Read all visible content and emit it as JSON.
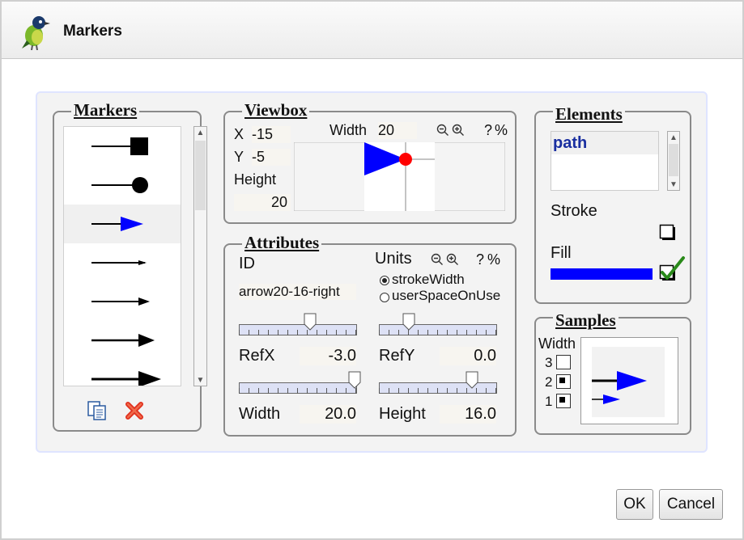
{
  "window": {
    "title": "Markers"
  },
  "markers_panel": {
    "legend": "Markers",
    "items": [
      {
        "icon": "square-end-marker-icon"
      },
      {
        "icon": "circle-end-marker-icon"
      },
      {
        "icon": "arrow-marker-icon",
        "selected": true
      },
      {
        "icon": "small-arrow-marker-icon"
      },
      {
        "icon": "medium-arrow-marker-icon"
      },
      {
        "icon": "large-arrow-marker-icon"
      },
      {
        "icon": "wide-arrow-marker-icon"
      }
    ],
    "copy_icon": "copy-icon",
    "delete_icon": "delete-icon"
  },
  "viewbox": {
    "legend": "Viewbox",
    "x_label": "X",
    "x_value": "-15",
    "y_label": "Y",
    "y_value": "-5",
    "height_label": "Height",
    "height_value": "20",
    "width_label": "Width",
    "width_value": "20",
    "help": "?",
    "percent": "%",
    "zoom_out_icon": "zoom-out-icon",
    "zoom_in_icon": "zoom-in-icon"
  },
  "attributes": {
    "legend": "Attributes",
    "id_label": "ID",
    "id_value": "arrow20-16-right",
    "units_label": "Units",
    "help": "?",
    "percent": "%",
    "units_options": [
      {
        "label": "strokeWidth",
        "selected": true
      },
      {
        "label": "userSpaceOnUse",
        "selected": false
      }
    ],
    "refx_label": "RefX",
    "refx_value": "-3.0",
    "refy_label": "RefY",
    "refy_value": "0.0",
    "width_label": "Width",
    "width_value": "20.0",
    "height_label": "Height",
    "height_value": "16.0"
  },
  "elements": {
    "legend": "Elements",
    "list": [
      "path"
    ],
    "stroke_label": "Stroke",
    "stroke_enabled": false,
    "fill_label": "Fill",
    "fill_enabled": true,
    "fill_color": "#0000ff"
  },
  "samples": {
    "legend": "Samples",
    "width_label": "Width",
    "widths": [
      {
        "label": "3",
        "checked": false
      },
      {
        "label": "2",
        "checked": true
      },
      {
        "label": "1",
        "checked": true
      }
    ]
  },
  "buttons": {
    "ok": "OK",
    "cancel": "Cancel"
  }
}
